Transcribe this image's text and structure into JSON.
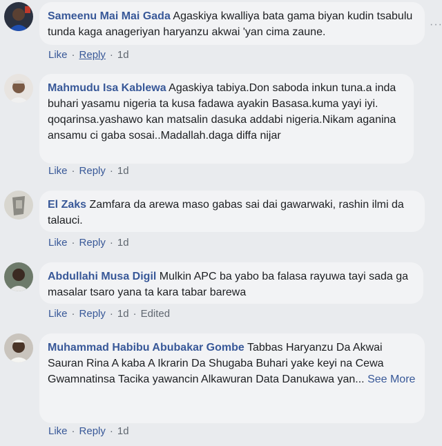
{
  "comments": [
    {
      "author": "Sameenu Mai Mai Gada",
      "text": "Agaskiya kwalliya bata gama biyan kudin tsabulu tunda kaga anageriyan haryanzu akwai 'yan cima zaune.",
      "like": "Like",
      "reply": "Reply",
      "time": "1d"
    },
    {
      "author": "Mahmudu Isa Kablewa",
      "text": "Agaskiya tabiya.Don saboda inkun tuna.a inda buhari yasamu nigeria ta kusa fadawa ayakin Basasa.kuma yayi iyi. qoqarinsa.yashawo kan matsalin dasuka addabi nigeria.Nikam aganina ansamu ci gaba sosai..Madallah.daga diffa nijar",
      "like": "Like",
      "reply": "Reply",
      "time": "1d"
    },
    {
      "author": "El Zaks",
      "text": "Zamfara da arewa maso gabas sai dai gawarwaki, rashin ilmi da talauci.",
      "like": "Like",
      "reply": "Reply",
      "time": "1d"
    },
    {
      "author": "Abdullahi Musa Digil",
      "text": "Mulkin APC ba yabo ba falasa rayuwa tayi sada ga masalar tsaro yana ta kara tabar barewa",
      "like": "Like",
      "reply": "Reply",
      "time": "1d",
      "edited": "Edited"
    },
    {
      "author": "Muhammad Habibu Abubakar Gombe",
      "text": "Tabbas Haryanzu Da Akwai Sauran Rina A kaba A Ikrarin Da Shugaba Buhari yake keyi na Cewa Gwamnatinsa Tacika yawancin Alkawuran Data Danukawa yan...",
      "see_more": "See More",
      "like": "Like",
      "reply": "Reply",
      "time": "1d"
    }
  ],
  "colors": {
    "background": "#e9ebee",
    "bubble": "#f2f3f5",
    "author": "#385898",
    "meta": "#606770"
  },
  "icons": [
    "avatar",
    "more-options-icon"
  ]
}
